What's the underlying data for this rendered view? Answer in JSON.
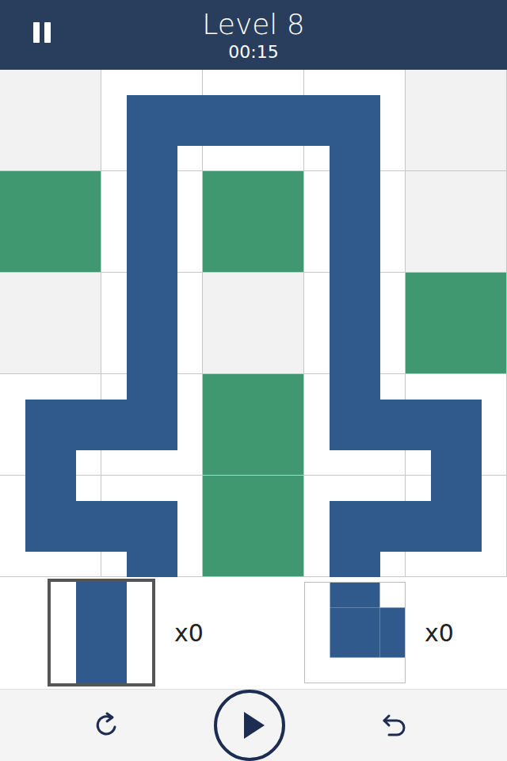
{
  "header": {
    "title": "Level 8",
    "time": "00:15"
  },
  "grid": [
    [
      {
        "kind": "empty"
      },
      {
        "kind": "pipe",
        "connections": [
          "right",
          "down"
        ]
      },
      {
        "kind": "pipe",
        "connections": [
          "left",
          "right"
        ]
      },
      {
        "kind": "pipe",
        "connections": [
          "left",
          "down"
        ]
      },
      {
        "kind": "empty"
      }
    ],
    [
      {
        "kind": "blocked"
      },
      {
        "kind": "pipe",
        "connections": [
          "up",
          "down"
        ]
      },
      {
        "kind": "blocked"
      },
      {
        "kind": "pipe",
        "connections": [
          "up",
          "down"
        ]
      },
      {
        "kind": "empty"
      }
    ],
    [
      {
        "kind": "empty"
      },
      {
        "kind": "pipe",
        "connections": [
          "up",
          "down"
        ]
      },
      {
        "kind": "empty"
      },
      {
        "kind": "pipe",
        "connections": [
          "up",
          "down"
        ]
      },
      {
        "kind": "blocked"
      }
    ],
    [
      {
        "kind": "pipe",
        "connections": [
          "right",
          "down"
        ]
      },
      {
        "kind": "pipe",
        "connections": [
          "up",
          "left"
        ]
      },
      {
        "kind": "blocked"
      },
      {
        "kind": "pipe",
        "connections": [
          "up",
          "right"
        ]
      },
      {
        "kind": "pipe",
        "connections": [
          "left",
          "down"
        ]
      }
    ],
    [
      {
        "kind": "pipe",
        "connections": [
          "up",
          "right"
        ]
      },
      {
        "kind": "pipe",
        "connections": [
          "left",
          "down"
        ]
      },
      {
        "kind": "blocked"
      },
      {
        "kind": "pipe",
        "connections": [
          "right",
          "down"
        ]
      },
      {
        "kind": "pipe",
        "connections": [
          "up",
          "left"
        ]
      }
    ]
  ],
  "tray": [
    {
      "connections": [
        "up",
        "down"
      ],
      "count": "x0",
      "selected": true
    },
    {
      "connections": [
        "up",
        "right"
      ],
      "count": "x0",
      "selected": false
    }
  ]
}
